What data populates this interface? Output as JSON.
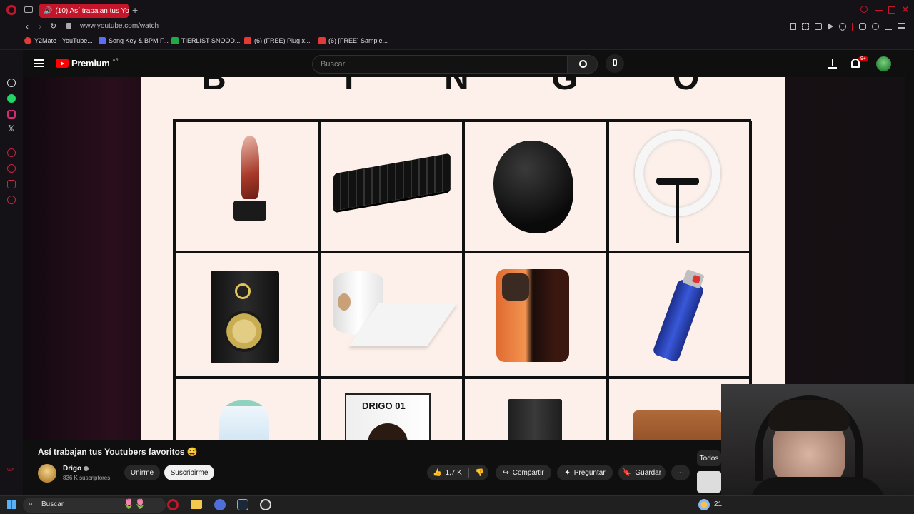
{
  "browser": {
    "active_tab": "(10) Así trabajan tus Yo",
    "url": "www.youtube.com/watch",
    "bookmarks": [
      {
        "label": "Y2Mate - YouTube...",
        "color": "#e53935"
      },
      {
        "label": "Song Key & BPM F...",
        "color": "#5b6cf9"
      },
      {
        "label": "TIERLIST SNOOD...",
        "color": "#22a845"
      },
      {
        "label": "(6) (FREE) Plug x...",
        "color": "#e53935"
      },
      {
        "label": "(6) [FREE] Sample...",
        "color": "#e53935"
      }
    ]
  },
  "youtube": {
    "logo_label": "Premium",
    "region": "AR",
    "search_placeholder": "Buscar",
    "notification_badge": "9+",
    "video": {
      "title": "Así trabajan tus Youtubers favoritos 😅",
      "bingo_letters": [
        "B",
        "I",
        "N",
        "G",
        "O"
      ],
      "items": [
        {
          "name": "trophy"
        },
        {
          "name": "keyboard"
        },
        {
          "name": "mousepad"
        },
        {
          "name": "ring light"
        },
        {
          "name": "studio monitor"
        },
        {
          "name": "toilet paper"
        },
        {
          "name": "phone"
        },
        {
          "name": "lighter"
        },
        {
          "name": "water jug"
        },
        {
          "name": "funko pop"
        },
        {
          "name": "hard drive"
        },
        {
          "name": "wallet"
        }
      ],
      "funko_label": "DRIGO 01"
    },
    "channel": {
      "name": "Drigo",
      "subscribers": "836 K suscriptores",
      "join_label": "Unirme",
      "subscribe_label": "Suscribirme"
    },
    "actions": {
      "likes": "1,7 K",
      "share_label": "Compartir",
      "ask_label": "Preguntar",
      "save_label": "Guardar"
    },
    "filter_chip": "Todos"
  },
  "taskbar": {
    "search_placeholder": "Buscar",
    "clock_partial": "21"
  }
}
